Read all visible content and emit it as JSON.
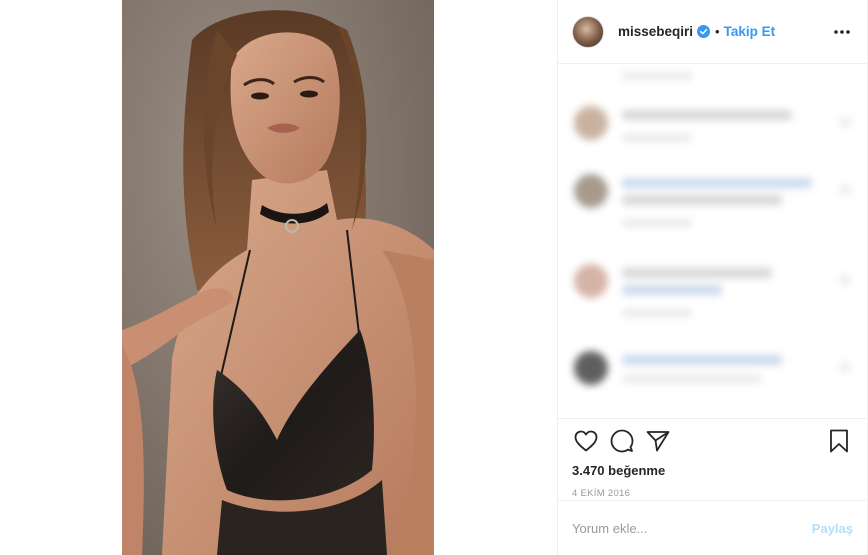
{
  "post": {
    "photo_alt": "",
    "header": {
      "username": "missebeqiri",
      "verified": true,
      "separator": "•",
      "follow_label": "Takip Et",
      "more_icon": "more-horizontal-icon"
    },
    "actions": {
      "like_icon": "heart-icon",
      "comment_icon": "comment-icon",
      "share_icon": "paper-plane-icon",
      "save_icon": "bookmark-icon"
    },
    "likes_text": "3.470 beğenme",
    "date_text": "4 EKİM 2016",
    "add_comment": {
      "placeholder": "Yorum ekle...",
      "post_label": "Paylaş"
    }
  },
  "colors": {
    "accent": "#3897f0",
    "post_disabled": "#b2dffc",
    "muted_text": "#999999",
    "border": "#efefef"
  }
}
